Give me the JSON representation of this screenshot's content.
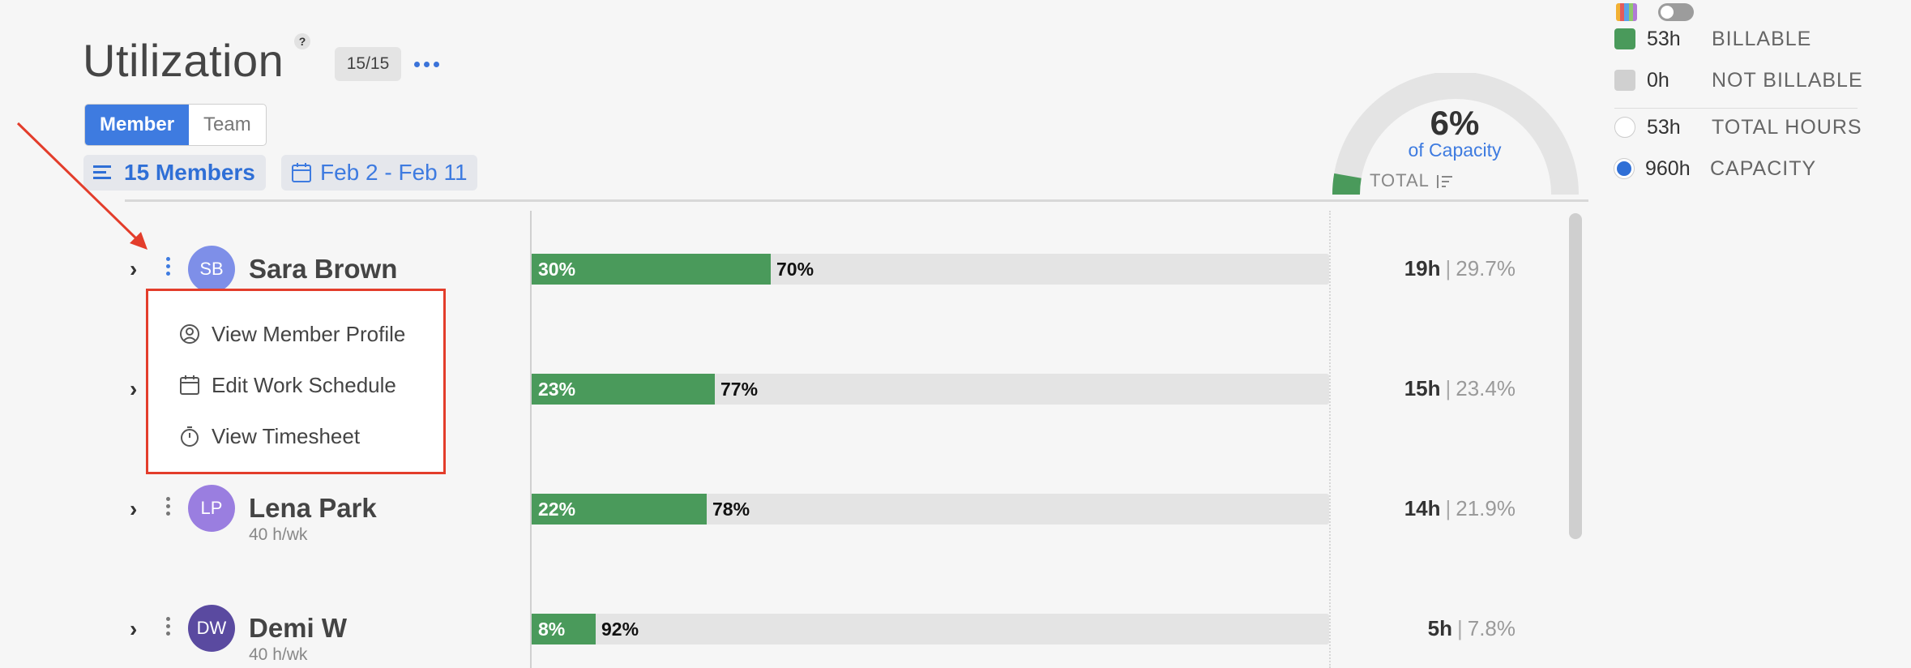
{
  "header": {
    "title": "Utilization",
    "help": "?",
    "count": "15/15",
    "view_tabs": [
      {
        "label": "Member",
        "active": true
      },
      {
        "label": "Team",
        "active": false
      }
    ],
    "members_filter": "15 Members",
    "date_range": "Feb 2 - Feb 11"
  },
  "summary": {
    "capacity_pct": "6%",
    "capacity_label": "of Capacity",
    "capacity_fraction": 0.055,
    "sort_label": "TOTAL"
  },
  "legend": [
    {
      "value": "53h",
      "label": "BILLABLE",
      "color": "#4a9a5b",
      "kind": "square"
    },
    {
      "value": "0h",
      "label": "NOT BILLABLE",
      "color": "#d0d0d0",
      "kind": "square"
    },
    {
      "value": "53h",
      "label": "TOTAL HOURS",
      "color": "#ffffff",
      "kind": "circle"
    },
    {
      "value": "960h",
      "label": "CAPACITY",
      "color": "#2f6fd6",
      "kind": "circle"
    }
  ],
  "rows": [
    {
      "initials": "SB",
      "name": "Sara Brown",
      "schedule": "",
      "avatar_color": "#7e8fe8",
      "billable_pct": "30%",
      "remaining_pct": "70%",
      "fill": 0.3,
      "hours": "19h",
      "share": "29.7%"
    },
    {
      "initials": "",
      "name": "",
      "schedule": "",
      "avatar_color": "",
      "billable_pct": "23%",
      "remaining_pct": "77%",
      "fill": 0.23,
      "hours": "15h",
      "share": "23.4%"
    },
    {
      "initials": "LP",
      "name": "Lena Park",
      "schedule": "40 h/wk",
      "avatar_color": "#9a7ee0",
      "billable_pct": "22%",
      "remaining_pct": "78%",
      "fill": 0.22,
      "hours": "14h",
      "share": "21.9%"
    },
    {
      "initials": "DW",
      "name": "Demi W",
      "schedule": "40 h/wk",
      "avatar_color": "#5a4aa0",
      "billable_pct": "8%",
      "remaining_pct": "92%",
      "fill": 0.08,
      "hours": "5h",
      "share": "7.8%"
    }
  ],
  "row_separator": "|",
  "menu": {
    "items": [
      {
        "label": "View Member Profile",
        "icon": "user-circle-icon"
      },
      {
        "label": "Edit Work Schedule",
        "icon": "calendar-icon"
      },
      {
        "label": "View Timesheet",
        "icon": "stopwatch-icon"
      }
    ]
  },
  "colors": {
    "accent": "#3e7be0",
    "billable": "#4a9a5b",
    "highlight": "#e33d2b"
  }
}
